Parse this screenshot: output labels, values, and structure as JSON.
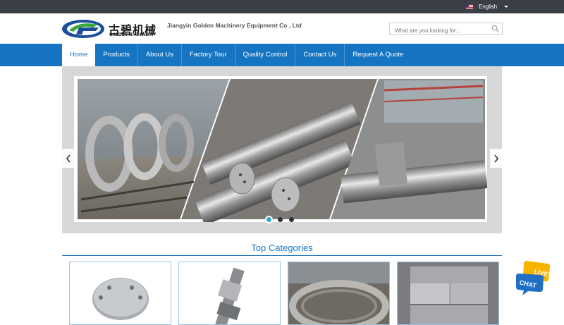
{
  "topbar": {
    "language": "English"
  },
  "header": {
    "logo_cn": "古碧机械",
    "logo_en": "GOLDEN MACHINERY",
    "company": "Jiangyin Golden Machinery Equipment Co , Ltd",
    "search_placeholder": "What are you looking for..."
  },
  "nav": {
    "items": [
      "Home",
      "Products",
      "About Us",
      "Factory Tour",
      "Quality Control",
      "Contact Us",
      "Request A Quote"
    ],
    "active": "Home"
  },
  "banner": {
    "slides": 3,
    "current_slide": 1
  },
  "top_categories": {
    "title": "Top Categories"
  },
  "colors": {
    "nav_blue": "#1575c2",
    "topbar": "#3a3f46",
    "accent_teal": "#2ca9cf"
  },
  "icons": [
    "us-flag-icon",
    "chevron-down-icon",
    "search-icon",
    "chevron-left-icon",
    "chevron-right-icon",
    "live-chat-icon"
  ]
}
